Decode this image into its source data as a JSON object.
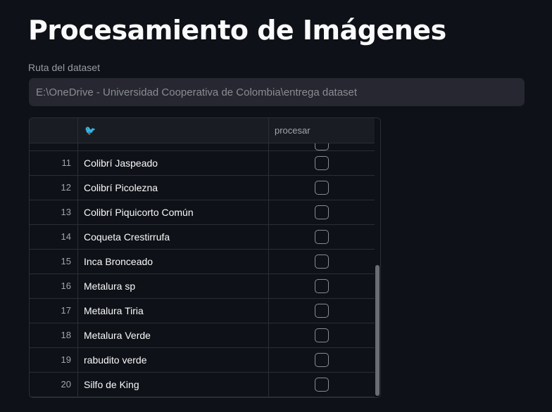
{
  "page": {
    "title": "Procesamiento de Imágenes"
  },
  "dataset_path": {
    "label": "Ruta del dataset",
    "value": "E:\\OneDrive - Universidad Cooperativa de Colombia\\entrega dataset"
  },
  "table": {
    "header_icon": "bird-icon",
    "header_icon_glyph": "🐦",
    "columns": [
      "",
      "",
      "procesar"
    ],
    "rows": [
      {
        "index": "11",
        "name": "Colibrí Jaspeado",
        "procesar": false
      },
      {
        "index": "12",
        "name": "Colibrí Picolezna",
        "procesar": false
      },
      {
        "index": "13",
        "name": "Colibrí Piquicorto Común",
        "procesar": false
      },
      {
        "index": "14",
        "name": "Coqueta Crestirrufa",
        "procesar": false
      },
      {
        "index": "15",
        "name": "Inca Bronceado",
        "procesar": false
      },
      {
        "index": "16",
        "name": "Metalura sp",
        "procesar": false
      },
      {
        "index": "17",
        "name": "Metalura Tiria",
        "procesar": false
      },
      {
        "index": "18",
        "name": "Metalura Verde",
        "procesar": false
      },
      {
        "index": "19",
        "name": "rabudito verde",
        "procesar": false
      },
      {
        "index": "20",
        "name": "Silfo de King",
        "procesar": false
      }
    ]
  },
  "colors": {
    "background": "#0e1117",
    "input_bg": "#262730",
    "header_bg": "#1a1c24",
    "grid_line": "#2c2e36",
    "accent_icon": "#c0392b"
  }
}
